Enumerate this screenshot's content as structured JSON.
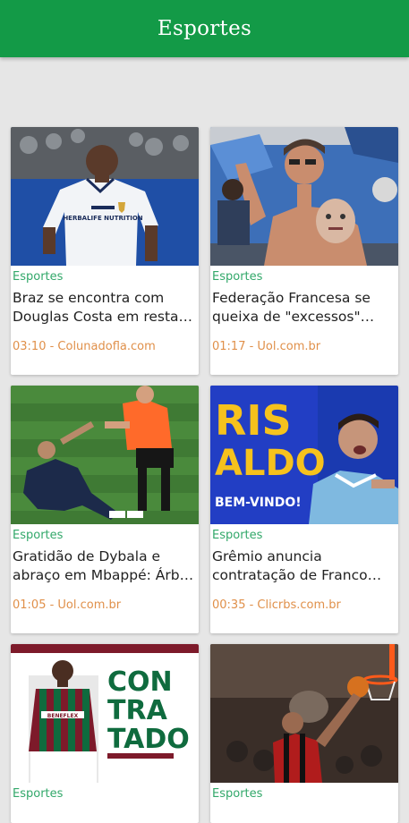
{
  "header": {
    "title": "Esportes"
  },
  "colors": {
    "primary": "#139a47",
    "category": "#32a86a",
    "meta": "#e0904a"
  },
  "cards": [
    {
      "category": "Esportes",
      "title": "Braz se encontra com Douglas Costa em resta…",
      "time": "03:10",
      "source": "Colunadofla.com",
      "meta": "03:10 - Colunadofla.com"
    },
    {
      "category": "Esportes",
      "title": "Federação Francesa se queixa de \"excessos\" do…",
      "time": "01:17",
      "source": "Uol.com.br",
      "meta": "01:17 - Uol.com.br"
    },
    {
      "category": "Esportes",
      "title": "Gratidão de Dybala e abraço em Mbappé: Árb…",
      "time": "01:05",
      "source": "Uol.com.br",
      "meta": "01:05 - Uol.com.br"
    },
    {
      "category": "Esportes",
      "title": "Grêmio anuncia contratação de Franco C…",
      "time": "00:35",
      "source": "Clicrbs.com.br",
      "meta": "00:35 - Clicrbs.com.br"
    },
    {
      "category": "Esportes",
      "title": "",
      "meta": ""
    },
    {
      "category": "Esportes",
      "title": "",
      "meta": ""
    }
  ],
  "image_text": {
    "kit_sponsor": "HERBALIFE NUTRITION",
    "banner_word": "RIS ALDO",
    "banner_sub": "BEM-VINDO!",
    "contratado": "CON TRA TADO",
    "jersey_sponsor": "BENEFLEX"
  }
}
